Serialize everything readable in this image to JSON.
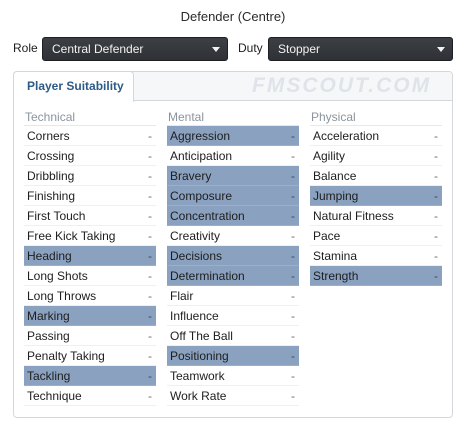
{
  "header": {
    "title": "Defender (Centre)"
  },
  "selectors": {
    "role_label": "Role",
    "role_value": "Central Defender",
    "duty_label": "Duty",
    "duty_value": "Stopper"
  },
  "tabs": {
    "active": "Player Suitability"
  },
  "watermark": "FMSCOUT.COM",
  "columns": {
    "technical": {
      "heading": "Technical",
      "items": [
        {
          "label": "Corners",
          "value": "-"
        },
        {
          "label": "Crossing",
          "value": "-"
        },
        {
          "label": "Dribbling",
          "value": "-"
        },
        {
          "label": "Finishing",
          "value": "-"
        },
        {
          "label": "First Touch",
          "value": "-"
        },
        {
          "label": "Free Kick Taking",
          "value": "-"
        },
        {
          "label": "Heading",
          "value": "-"
        },
        {
          "label": "Long Shots",
          "value": "-"
        },
        {
          "label": "Long Throws",
          "value": "-"
        },
        {
          "label": "Marking",
          "value": "-"
        },
        {
          "label": "Passing",
          "value": "-"
        },
        {
          "label": "Penalty Taking",
          "value": "-"
        },
        {
          "label": "Tackling",
          "value": "-"
        },
        {
          "label": "Technique",
          "value": "-"
        }
      ]
    },
    "mental": {
      "heading": "Mental",
      "items": [
        {
          "label": "Aggression",
          "value": "-"
        },
        {
          "label": "Anticipation",
          "value": "-"
        },
        {
          "label": "Bravery",
          "value": "-"
        },
        {
          "label": "Composure",
          "value": "-"
        },
        {
          "label": "Concentration",
          "value": "-"
        },
        {
          "label": "Creativity",
          "value": "-"
        },
        {
          "label": "Decisions",
          "value": "-"
        },
        {
          "label": "Determination",
          "value": "-"
        },
        {
          "label": "Flair",
          "value": "-"
        },
        {
          "label": "Influence",
          "value": "-"
        },
        {
          "label": "Off The Ball",
          "value": "-"
        },
        {
          "label": "Positioning",
          "value": "-"
        },
        {
          "label": "Teamwork",
          "value": "-"
        },
        {
          "label": "Work Rate",
          "value": "-"
        }
      ]
    },
    "physical": {
      "heading": "Physical",
      "items": [
        {
          "label": "Acceleration",
          "value": "-"
        },
        {
          "label": "Agility",
          "value": "-"
        },
        {
          "label": "Balance",
          "value": "-"
        },
        {
          "label": "Jumping",
          "value": "-"
        },
        {
          "label": "Natural Fitness",
          "value": "-"
        },
        {
          "label": "Pace",
          "value": "-"
        },
        {
          "label": "Stamina",
          "value": "-"
        },
        {
          "label": "Strength",
          "value": "-"
        }
      ]
    }
  },
  "colors": {
    "highlight": "#8aa1bf",
    "tab_text": "#2d5a86",
    "select_bg": "#33363a"
  }
}
